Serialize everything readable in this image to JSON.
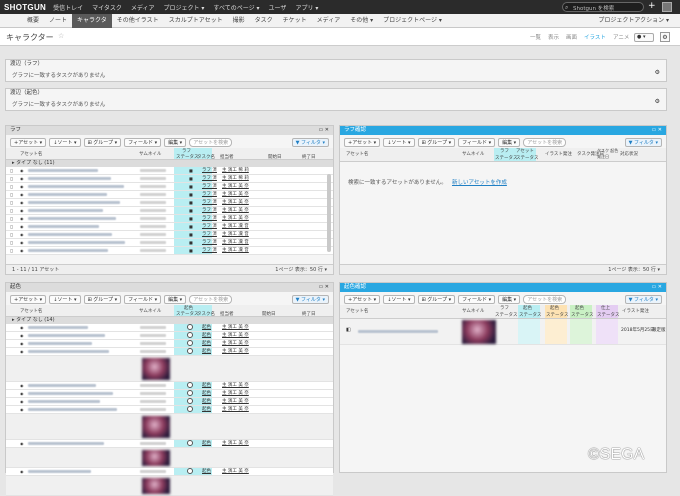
{
  "app": {
    "logo": "SHOTGUN",
    "nav": [
      "受信トレイ",
      "マイタスク",
      "メディア",
      "プロジェクト ▾",
      "すべてのページ ▾",
      "ユーザ",
      "アプリ ▾"
    ],
    "search_placeholder": "Shotgun を検索"
  },
  "project_nav": {
    "items": [
      "概要",
      "ノート",
      "キャラクタ",
      "その他イラスト",
      "スカルプトアセット",
      "撮影",
      "タスク",
      "チケット",
      "メディア",
      "その他 ▾",
      "プロジェクトページ ▾"
    ],
    "active": "キャラクタ",
    "actions": "プロジェクトアクション ▾"
  },
  "page": {
    "title": "キャラクター",
    "view_tabs": [
      "一覧",
      "表示",
      "画面",
      "イラスト",
      "アニメ",
      "FX"
    ],
    "active_tab": "イラスト",
    "toggle": "● ▾",
    "gear": "⚙"
  },
  "note_panels": [
    {
      "title": "渡辺（ラフ）",
      "body": "グラフに一致するタスクがありません",
      "gear": "⚙"
    },
    {
      "title": "渡辺（起色）",
      "body": "グラフに一致するタスクがありません",
      "gear": "⚙"
    }
  ],
  "toolbar": {
    "add": "+アセット ▾",
    "sort": "↓ソート ▾",
    "group": "⊞ グループ ▾",
    "fields": "フィールド ▾",
    "edit": "編集 ▾",
    "search": "アセットを検索",
    "filter": "▼ フィルタ ▾"
  },
  "rough": {
    "title": "ラフ",
    "headers": [
      "アセット名",
      "サムネイル",
      "ラフ",
      "ステータス",
      "タスク名",
      "担当者",
      "開始日",
      "終了日"
    ],
    "group": "▸ タイプ なし (11)",
    "rows": [
      {
        "task": "ラフ 済",
        "person": "主 演工 稀 莉"
      },
      {
        "task": "ラフ 済",
        "person": "主 演工 稀 莉"
      },
      {
        "task": "ラフ 済",
        "person": "主 演工 美 奈"
      },
      {
        "task": "ラフ 済",
        "person": "主 演工 美 奈"
      },
      {
        "task": "ラフ 済",
        "person": "主 演工 美 奈"
      },
      {
        "task": "ラフ 済",
        "person": "主 演工 美 奈"
      },
      {
        "task": "ラフ 済",
        "person": "主 演工 美 奈"
      },
      {
        "task": "ラフ 済",
        "person": "主 演工 凜 音"
      },
      {
        "task": "ラフ 済",
        "person": "主 演工 凜 音"
      },
      {
        "task": "ラフ 済",
        "person": "主 演工 凜 音"
      },
      {
        "task": "ラフ 済",
        "person": "主 演工 凜 音"
      }
    ],
    "footer": "1 - 11 / 11 アセット",
    "pager": "1ページ  表示：50 行 ▾"
  },
  "rough_check": {
    "title": "ラフ確認",
    "headers": [
      "アセット名",
      "サムネイル",
      "ラフ",
      "ステータス",
      "アセット",
      "ステータス",
      "イラスト発注",
      "タスク発注日",
      "タスク 起色 発注日",
      "対応状況"
    ],
    "empty_message": "検索に一致するアセットがありません。",
    "create_link": "新しいアセットを作成",
    "pager": "1ページ  表示：50 行 ▾"
  },
  "color": {
    "title": "起色",
    "headers": [
      "アセット名",
      "サムネイル",
      "起色",
      "ステータス",
      "タスク名",
      "担当者",
      "開始日",
      "終了日"
    ],
    "group": "▸ タイプ なし (14)",
    "rows": [
      {
        "task": "起色",
        "person": "主 演工 美 奈"
      },
      {
        "task": "起色",
        "person": "主 演工 美 奈"
      },
      {
        "task": "起色",
        "person": "主 演工 美 奈"
      },
      {
        "task": "起色",
        "person": "主 演工 美 奈"
      },
      {
        "task": "起色",
        "person": "主 演工 美 奈"
      },
      {
        "task": "起色",
        "person": "主 演工 美 奈"
      },
      {
        "task": "起色",
        "person": "主 演工 美 奈"
      },
      {
        "task": "起色",
        "person": "主 演工 美 奈"
      },
      {
        "task": "起色",
        "person": "主 演工 美 奈"
      },
      {
        "task": "起色",
        "person": "主 演工 美 奈"
      }
    ]
  },
  "color_check": {
    "title": "起色確認",
    "headers": [
      "アセット名",
      "サムネイル",
      "ラフ",
      "ステータス",
      "起色",
      "ステータス",
      "起色",
      "ステータス",
      "起色",
      "ステータス",
      "仕上",
      "ステータス",
      "イラスト発注"
    ],
    "row": {
      "date": "2018年5月25日",
      "status": "限定版"
    }
  },
  "watermark": "©SEGA",
  "colors": {
    "topbar": "#2b2b2b",
    "accent": "#29a7e1",
    "cyan": "#b9eef2",
    "active_tab": "#5a5a5a"
  }
}
